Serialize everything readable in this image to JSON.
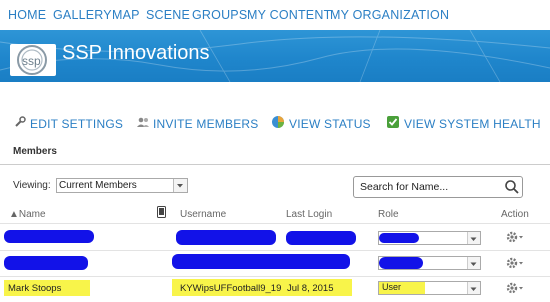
{
  "nav": {
    "items": [
      "HOME",
      "GALLERY",
      "MAP",
      "SCENE",
      "GROUPS",
      "MY CONTENT",
      "MY ORGANIZATION"
    ]
  },
  "banner": {
    "logo_text": "ssp",
    "org_name": "SSP Innovations"
  },
  "actions": {
    "edit_settings": "EDIT SETTINGS",
    "invite_members": "INVITE MEMBERS",
    "view_status": "VIEW STATUS",
    "view_system_health": "VIEW SYSTEM HEALTH"
  },
  "members": {
    "heading": "Members",
    "viewing_label": "Viewing:",
    "viewing_value": "Current Members",
    "search_placeholder": "Search for Name...",
    "columns": {
      "name": "▲Name",
      "username": "Username",
      "last_login": "Last Login",
      "role": "Role",
      "action": "Action"
    },
    "visible_row": {
      "name": "Mark Stoops",
      "username": "KYWipsUFFootball9_19",
      "last_login": "Jul 8, 2015",
      "role": "User"
    }
  },
  "colors": {
    "link": "#2b7fc4",
    "banner": "#1f86cc",
    "redaction": "#1212e8",
    "highlight": "#f8f44a"
  }
}
